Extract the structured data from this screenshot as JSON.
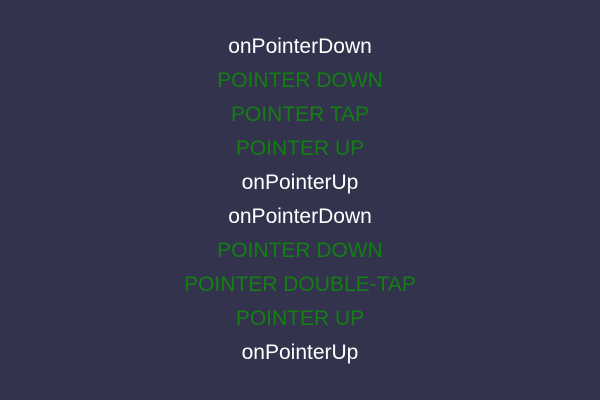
{
  "colors": {
    "background": "#33334d",
    "handler_text": "#ffffff",
    "event_text": "#137f13"
  },
  "log": [
    {
      "text": "onPointerDown",
      "kind": "handler"
    },
    {
      "text": "POINTER DOWN",
      "kind": "event"
    },
    {
      "text": "POINTER TAP",
      "kind": "event"
    },
    {
      "text": "POINTER UP",
      "kind": "event"
    },
    {
      "text": "onPointerUp",
      "kind": "handler"
    },
    {
      "text": "onPointerDown",
      "kind": "handler"
    },
    {
      "text": "POINTER DOWN",
      "kind": "event"
    },
    {
      "text": "POINTER DOUBLE-TAP",
      "kind": "event"
    },
    {
      "text": "POINTER UP",
      "kind": "event"
    },
    {
      "text": "onPointerUp",
      "kind": "handler"
    }
  ]
}
